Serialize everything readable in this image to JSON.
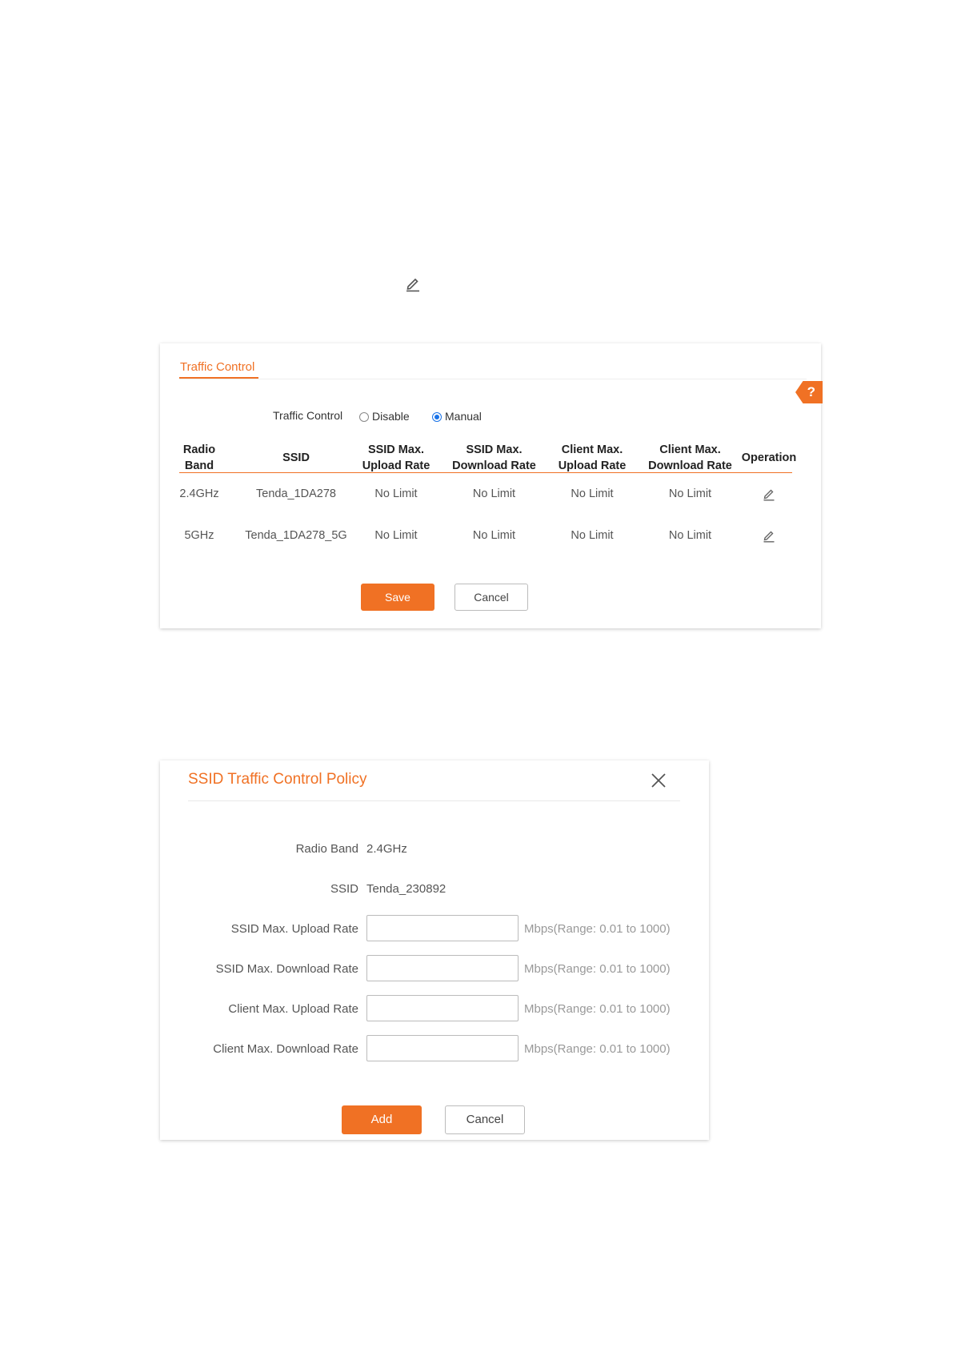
{
  "traffic_control_panel": {
    "tab_title": "Traffic Control",
    "help_label": "?",
    "mode_label": "Traffic Control",
    "options": [
      {
        "label": "Disable",
        "selected": false
      },
      {
        "label": "Manual",
        "selected": true
      }
    ],
    "columns": [
      [
        "Radio",
        "Band"
      ],
      [
        "SSID"
      ],
      [
        "SSID Max.",
        "Upload Rate"
      ],
      [
        "SSID Max.",
        "Download Rate"
      ],
      [
        "Client Max.",
        "Upload Rate"
      ],
      [
        "Client Max.",
        "Download Rate"
      ],
      [
        "Operation"
      ]
    ],
    "rows": [
      {
        "band": "2.4GHz",
        "ssid": "Tenda_1DA278",
        "ssid_up": "No Limit",
        "ssid_down": "No Limit",
        "client_up": "No Limit",
        "client_down": "No Limit"
      },
      {
        "band": "5GHz",
        "ssid": "Tenda_1DA278_5G",
        "ssid_up": "No Limit",
        "ssid_down": "No Limit",
        "client_up": "No Limit",
        "client_down": "No Limit"
      }
    ],
    "save_label": "Save",
    "cancel_label": "Cancel"
  },
  "policy_dialog": {
    "title": "SSID Traffic Control Policy",
    "radio_band_label": "Radio Band",
    "radio_band_value": "2.4GHz",
    "ssid_label": "SSID",
    "ssid_value": "Tenda_230892",
    "fields": [
      {
        "label": "SSID Max. Upload Rate",
        "value": "",
        "hint": "Mbps(Range: 0.01 to 1000)"
      },
      {
        "label": "SSID Max. Download Rate",
        "value": "",
        "hint": "Mbps(Range: 0.01 to 1000)"
      },
      {
        "label": "Client Max. Upload Rate",
        "value": "",
        "hint": "Mbps(Range: 0.01 to 1000)"
      },
      {
        "label": "Client Max. Download Rate",
        "value": "",
        "hint": "Mbps(Range: 0.01 to 1000)"
      }
    ],
    "add_label": "Add",
    "cancel_label": "Cancel"
  },
  "icons": {
    "top": "pencil-icon",
    "row_edit": "pencil-icon",
    "close": "close-icon"
  },
  "colors": {
    "accent": "#f07124",
    "radio_selected": "#1a73e8"
  }
}
